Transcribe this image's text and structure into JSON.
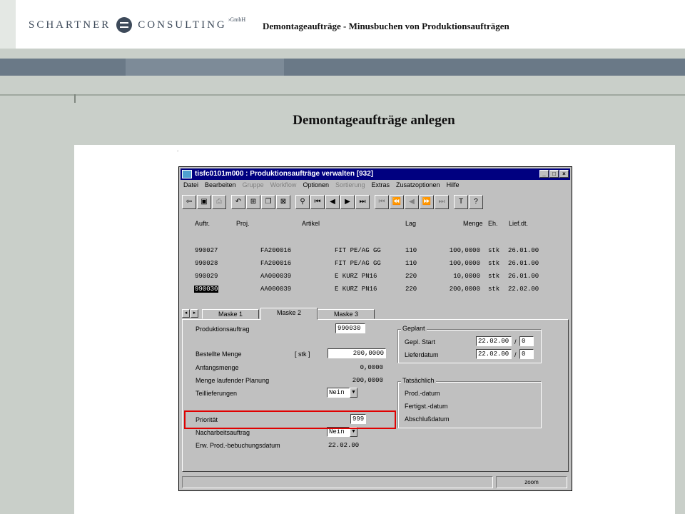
{
  "header": {
    "logo_left": "SCHARTNER",
    "logo_right": "CONSULTING",
    "logo_suffix": "GmbH",
    "title": "Demontageaufträge - Minusbuchen von Produktionsaufträgen"
  },
  "page": {
    "title": "Demontageaufträge anlegen",
    "dot": "."
  },
  "window": {
    "title": "tisfc0101m000 : Produktionsaufträge verwalten [932]",
    "controls": {
      "minimize": "_",
      "maximize": "□",
      "close": "×"
    },
    "menu": [
      {
        "label": "Datei",
        "disabled": false
      },
      {
        "label": "Bearbeiten",
        "disabled": false
      },
      {
        "label": "Gruppe",
        "disabled": true
      },
      {
        "label": "Workflow",
        "disabled": true
      },
      {
        "label": "Optionen",
        "disabled": false
      },
      {
        "label": "Sortierung",
        "disabled": true
      },
      {
        "label": "Extras",
        "disabled": false
      },
      {
        "label": "Zusatzoptionen",
        "disabled": false
      },
      {
        "label": "Hilfe",
        "disabled": false
      }
    ],
    "grid": {
      "headers": {
        "auftr": "Auftr.",
        "proj": "Proj.",
        "artikel": "Artikel",
        "lag": "Lag",
        "menge": "Menge",
        "eh": "Eh.",
        "lief": "Lief.dt."
      },
      "rows": [
        {
          "auftr": "990027",
          "proj": "FA200016",
          "artikel": "FIT PE/AG GG",
          "lag": "110",
          "menge": "100,0000",
          "eh": "stk",
          "lief": "26.01.00"
        },
        {
          "auftr": "990028",
          "proj": "FA200016",
          "artikel": "FIT PE/AG GG",
          "lag": "110",
          "menge": "100,0000",
          "eh": "stk",
          "lief": "26.01.00"
        },
        {
          "auftr": "990029",
          "proj": "AA000039",
          "artikel": "E KURZ PN16",
          "lag": "220",
          "menge": "10,0000",
          "eh": "stk",
          "lief": "26.01.00"
        },
        {
          "auftr": "990030",
          "proj": "AA000039",
          "artikel": "E KURZ PN16",
          "lag": "220",
          "menge": "200,0000",
          "eh": "stk",
          "lief": "22.02.00"
        }
      ]
    },
    "tabs": [
      "Maske 1",
      "Maske 2",
      "Maske 3"
    ],
    "form": {
      "produktionsauftrag_label": "Produktionsauftrag",
      "produktionsauftrag_value": "990030",
      "bestellte_menge_label": "Bestellte Menge",
      "bestellte_menge_unit": "[ stk ]",
      "bestellte_menge_value": "200,0000",
      "anfangsmenge_label": "Anfangsmenge",
      "anfangsmenge_value": "0,0000",
      "menge_planung_label": "Menge laufender Planung",
      "menge_planung_value": "200,0000",
      "teillieferungen_label": "Teillieferungen",
      "teillieferungen_value": "Nein",
      "prioritaet_label": "Priorität",
      "prioritaet_value": "999",
      "nacharbeit_label": "Nacharbeitsauftrag",
      "nacharbeit_value": "Nein",
      "erw_label": "Erw. Prod.-bebuchungsdatum",
      "erw_value": "22.02.00",
      "geplant_title": "Geplant",
      "gepl_start_label": "Gepl. Start",
      "gepl_start_value": "22.02.00",
      "gepl_start_sub": "0",
      "lieferdatum_label": "Lieferdatum",
      "lieferdatum_value": "22.02.00",
      "lieferdatum_sub": "0",
      "slash": "/",
      "tatsaechlich_title": "Tatsächlich",
      "prod_datum_label": "Prod.-datum",
      "fertigst_label": "Fertigst.-datum",
      "abschluss_label": "Abschlußdatum"
    },
    "status": {
      "zoom": "zoom"
    }
  },
  "colors": {
    "titlebar": "#000080",
    "highlight": "#e00000",
    "banner": "#6a7987"
  }
}
